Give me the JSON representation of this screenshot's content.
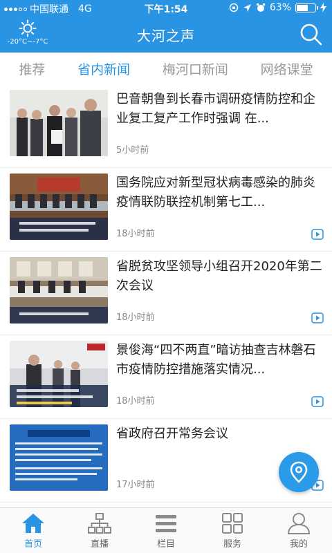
{
  "status_bar": {
    "carrier": "中国联通",
    "network": "4G",
    "time": "下午1:54",
    "battery": "63%",
    "battery_level": 0.63
  },
  "header": {
    "weather_temp": "-20°C~-7°C",
    "title": "大河之声"
  },
  "tabs": [
    {
      "label": "推荐",
      "active": false
    },
    {
      "label": "省内新闻",
      "active": true
    },
    {
      "label": "梅河口新闻",
      "active": false
    },
    {
      "label": "网络课堂",
      "active": false
    }
  ],
  "news": [
    {
      "title": "巴音朝鲁到长春市调研疫情防控和企业复工复产工作时强调 在...",
      "time": "5小时前",
      "has_video": false
    },
    {
      "title": "国务院应对新型冠状病毒感染的肺炎疫情联防联控机制第七工...",
      "time": "18小时前",
      "has_video": true
    },
    {
      "title": "省脱贫攻坚领导小组召开2020年第二次会议",
      "time": "18小时前",
      "has_video": true
    },
    {
      "title": "景俊海“四不两直”暗访抽查吉林磐石市疫情防控措施落实情况...",
      "time": "18小时前",
      "has_video": true
    },
    {
      "title": "省政府召开常务会议",
      "time": "17小时前",
      "has_video": true
    }
  ],
  "bottom_nav": [
    {
      "label": "首页",
      "icon": "home-icon",
      "active": true
    },
    {
      "label": "直播",
      "icon": "broadcast-tree-icon",
      "active": false
    },
    {
      "label": "栏目",
      "icon": "menu-icon",
      "active": false
    },
    {
      "label": "服务",
      "icon": "grid-icon",
      "active": false
    },
    {
      "label": "我的",
      "icon": "user-icon",
      "active": false
    }
  ],
  "colors": {
    "accent": "#2a94e4",
    "inactive_tab": "#999999"
  }
}
